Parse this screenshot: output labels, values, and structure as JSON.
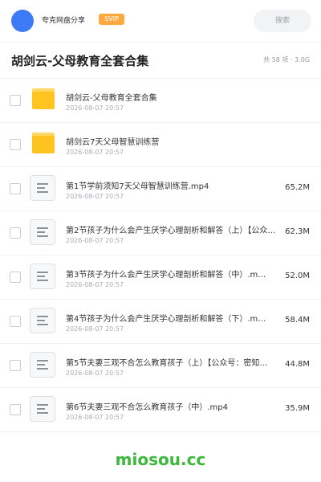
{
  "header": {
    "app_name": "夸克网盘分享",
    "badge": "SVIP",
    "search_placeholder": "搜索"
  },
  "page": {
    "title": "胡剑云-父母教育全套合集",
    "summary": "共 58 项 · 3.0G"
  },
  "items": [
    {
      "type": "folder",
      "name": "胡剑云-父母教育全套合集",
      "date": "2026-08-07 20:57",
      "size": ""
    },
    {
      "type": "folder",
      "name": "胡剑云7天父母智慧训练营",
      "date": "2026-08-07 20:57",
      "size": ""
    },
    {
      "type": "file",
      "name": "第1节学前须知7天父母智慧训练营.mp4",
      "date": "2026-08-07 20:57",
      "size": "65.2M"
    },
    {
      "type": "file",
      "name": "第2节孩子为什么会产生厌学心理剖析和解答（上）【公众号：密知…",
      "date": "2026-08-07 20:57",
      "size": "62.3M"
    },
    {
      "type": "file",
      "name": "第3节孩子为什么会产生厌学心理剖析和解答（中）.m…",
      "date": "2026-08-07 20:57",
      "size": "52.0M"
    },
    {
      "type": "file",
      "name": "第4节孩子为什么会产生厌学心理剖析和解答（下）.m…",
      "date": "2026-08-07 20:57",
      "size": "58.4M"
    },
    {
      "type": "file",
      "name": "第5节夫妻三观不合怎么教育孩子（上）【公众号：密知…",
      "date": "2026-08-07 20:57",
      "size": "44.8M"
    },
    {
      "type": "file",
      "name": "第6节夫妻三观不合怎么教育孩子（中）.mp4",
      "date": "2026-08-07 20:57",
      "size": "35.9M"
    }
  ],
  "watermark": "miosou.cc",
  "colors": {
    "avatar": "#3d7bf6",
    "badge": "#ffa940",
    "folder": "#ffc41f",
    "watermark": "#3cb83c"
  }
}
